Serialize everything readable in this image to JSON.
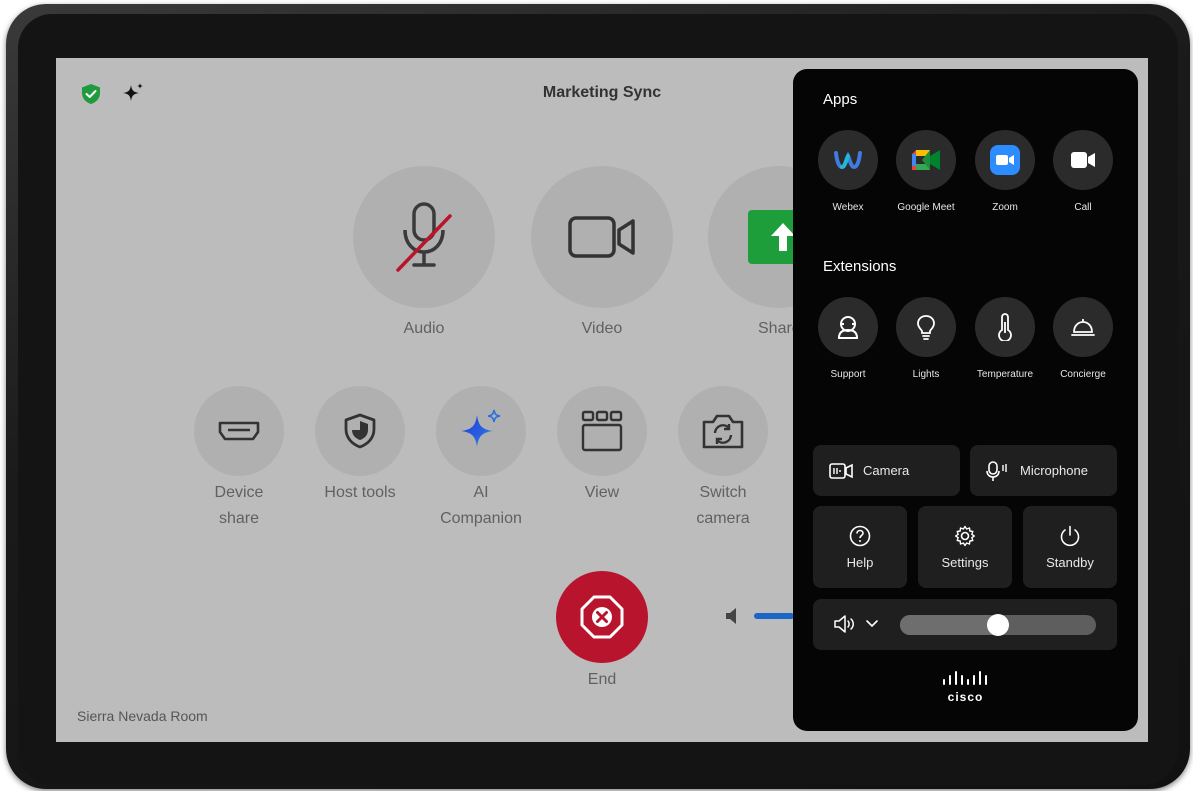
{
  "meeting": {
    "title": "Marketing Sync",
    "room": "Sierra Nevada Room"
  },
  "main_controls": [
    {
      "label": "Audio",
      "icon": "microphone-muted-icon"
    },
    {
      "label": "Video",
      "icon": "video-camera-icon"
    },
    {
      "label": "Share",
      "icon": "share-arrow-icon"
    }
  ],
  "secondary_controls": [
    {
      "line1": "Device",
      "line2": "share",
      "icon": "hdmi-icon"
    },
    {
      "line1": "Host tools",
      "line2": "",
      "icon": "shield-icon"
    },
    {
      "line1": "AI",
      "line2": "Companion",
      "icon": "sparkle-icon"
    },
    {
      "line1": "View",
      "line2": "",
      "icon": "layout-grid-icon"
    },
    {
      "line1": "Switch",
      "line2": "camera",
      "icon": "switch-camera-icon"
    }
  ],
  "end_call": {
    "label": "End",
    "color": "#b8142e"
  },
  "panel": {
    "apps_title": "Apps",
    "apps": [
      {
        "label": "Webex",
        "icon": "webex-icon"
      },
      {
        "label": "Google Meet",
        "icon": "google-meet-icon"
      },
      {
        "label": "Zoom",
        "icon": "zoom-icon"
      },
      {
        "label": "Call",
        "icon": "call-video-icon"
      }
    ],
    "extensions_title": "Extensions",
    "extensions": [
      {
        "label": "Support",
        "icon": "support-icon"
      },
      {
        "label": "Lights",
        "icon": "lightbulb-icon"
      },
      {
        "label": "Temperature",
        "icon": "thermometer-icon"
      },
      {
        "label": "Concierge",
        "icon": "bell-icon"
      }
    ],
    "camera_label": "Camera",
    "microphone_label": "Microphone",
    "help_label": "Help",
    "settings_label": "Settings",
    "standby_label": "Standby",
    "volume_level": 0.5,
    "brand": "cisco"
  },
  "colors": {
    "accent_blue": "#1a66c7",
    "secure_green": "#1f9a3d",
    "share_green": "#1e9e3a"
  }
}
